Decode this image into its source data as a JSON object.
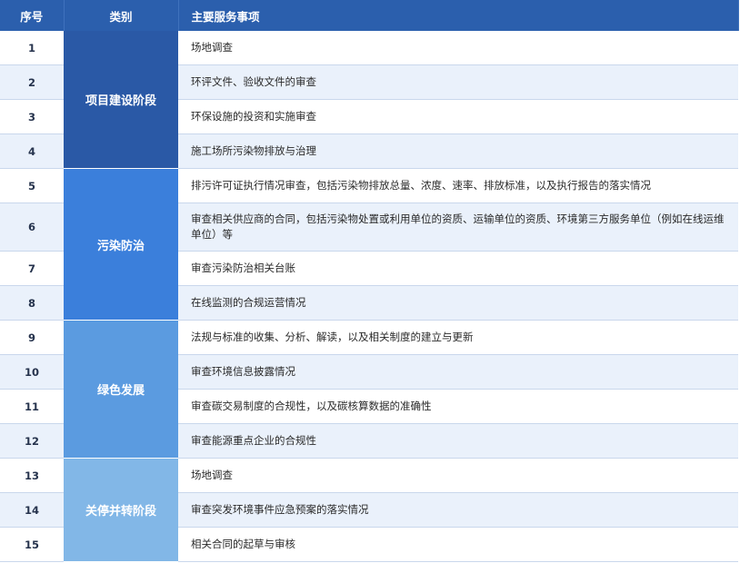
{
  "header": {
    "num": "序号",
    "category": "类别",
    "item": "主要服务事项"
  },
  "groups": [
    {
      "label": "项目建设阶段",
      "rows": [
        {
          "num": "1",
          "item": "场地调查"
        },
        {
          "num": "2",
          "item": "环评文件、验收文件的审查"
        },
        {
          "num": "3",
          "item": "环保设施的投资和实施审查"
        },
        {
          "num": "4",
          "item": "施工场所污染物排放与治理"
        }
      ]
    },
    {
      "label": "污染防治",
      "rows": [
        {
          "num": "5",
          "item": "排污许可证执行情况审查，包括污染物排放总量、浓度、速率、排放标准，以及执行报告的落实情况"
        },
        {
          "num": "6",
          "item": "审查相关供应商的合同，包括污染物处置或利用单位的资质、运输单位的资质、环境第三方服务单位（例如在线运维单位）等"
        },
        {
          "num": "7",
          "item": "审查污染防治相关台账"
        },
        {
          "num": "8",
          "item": "在线监测的合规运营情况"
        }
      ]
    },
    {
      "label": "绿色发展",
      "rows": [
        {
          "num": "9",
          "item": "法规与标准的收集、分析、解读，以及相关制度的建立与更新"
        },
        {
          "num": "10",
          "item": "审查环境信息披露情况"
        },
        {
          "num": "11",
          "item": "审查碳交易制度的合规性，以及碳核算数据的准确性"
        },
        {
          "num": "12",
          "item": "审查能源重点企业的合规性"
        }
      ]
    },
    {
      "label": "关停并转阶段",
      "rows": [
        {
          "num": "13",
          "item": "场地调查"
        },
        {
          "num": "14",
          "item": "审查突发环境事件应急预案的落实情况"
        },
        {
          "num": "15",
          "item": "相关合同的起草与审核"
        }
      ]
    }
  ]
}
